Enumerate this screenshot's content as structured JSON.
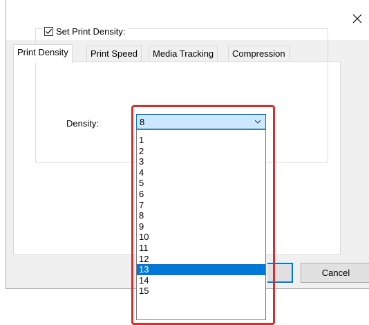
{
  "dialog": {
    "tabs": [
      {
        "label": "Print Density",
        "active": true
      },
      {
        "label": "Print Speed",
        "active": false
      },
      {
        "label": "Media Tracking",
        "active": false
      },
      {
        "label": "Compression",
        "active": false
      }
    ],
    "group": {
      "checkbox_label": "Set Print Density:",
      "checked": true,
      "density_label": "Density:",
      "selected_value": "8",
      "options": [
        "1",
        "2",
        "3",
        "4",
        "5",
        "6",
        "7",
        "8",
        "9",
        "10",
        "11",
        "12",
        "13",
        "14",
        "15"
      ],
      "hovered_option": "13"
    },
    "buttons": {
      "cancel_label": "Cancel"
    }
  },
  "colors": {
    "accent": "#0078d7",
    "select_bg": "#cce8ff",
    "highlight_box": "#e02a2a"
  }
}
